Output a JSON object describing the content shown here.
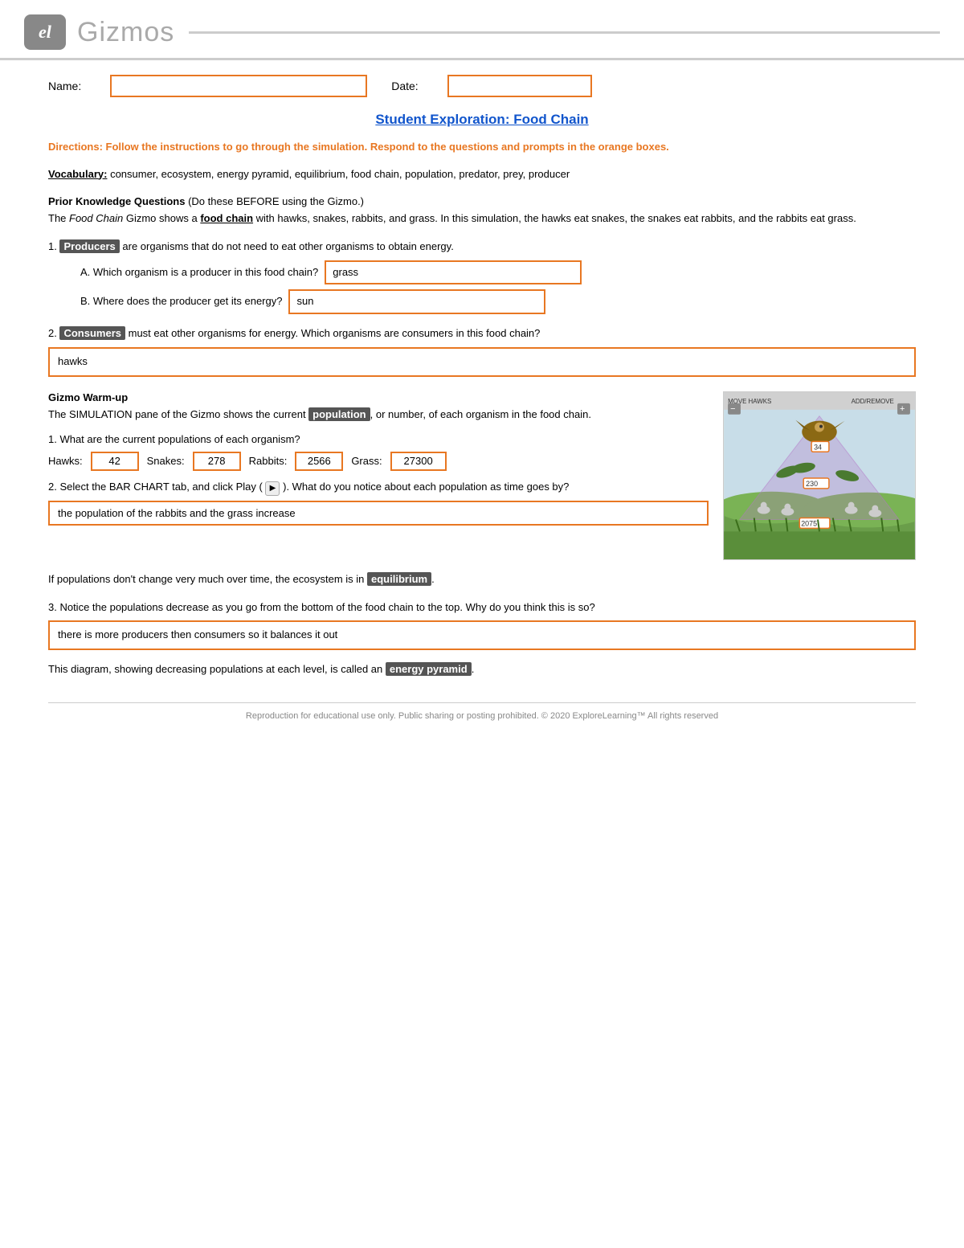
{
  "header": {
    "logo_text": "el",
    "title": "Gizmos"
  },
  "form": {
    "name_label": "Name:",
    "date_label": "Date:",
    "name_value": "",
    "date_value": ""
  },
  "document": {
    "title": "Student Exploration: Food Chain",
    "directions": "Directions: Follow the instructions to go through the simulation. Respond to the questions and prompts in the orange boxes.",
    "vocab_label": "Vocabulary:",
    "vocab_text": " consumer, ecosystem, energy pyramid, equilibrium, food chain, population, predator, prey, producer",
    "prior_knowledge_label": "Prior Knowledge Questions",
    "prior_knowledge_paren": "(Do these BEFORE using the Gizmo.)",
    "prior_knowledge_body": "The Food Chain Gizmo shows a food chain with hawks, snakes, rabbits, and grass. In this simulation, the hawks eat snakes, the snakes eat rabbits, and the rabbits eat grass.",
    "q1_text": "Producers are organisms that do not need to eat other organisms to obtain energy.",
    "q1a_label": "A. Which organism is a producer in this food chain?",
    "q1a_answer": "grass",
    "q1b_label": "B. Where does the producer get its energy?",
    "q1b_answer": "sun",
    "q2_text": "Consumers must eat other organisms for energy. Which organisms are consumers in this food chain?",
    "q2_answer": "hawks",
    "gizmo_warmup_title": "Gizmo Warm-up",
    "gizmo_warmup_body_pre": "The SIMULATION pane of the Gizmo shows the current ",
    "gizmo_warmup_highlight": "population",
    "gizmo_warmup_body_post": ", or number, of each organism in the food chain.",
    "pop_q1": "1.  What are the current populations of each organism?",
    "pop_hawks_label": "Hawks:",
    "pop_hawks_value": "42",
    "pop_snakes_label": "Snakes:",
    "pop_snakes_value": "278",
    "pop_rabbits_label": "Rabbits:",
    "pop_rabbits_value": "2566",
    "pop_grass_label": "Grass:",
    "pop_grass_value": "27300",
    "pop_q2": "2.  Select the BAR CHART tab, and click Play (",
    "pop_q2_play": "▶",
    "pop_q2_post": "). What do you notice about each population as time goes by?",
    "pop_q2_answer": "the population of the rabbits and the grass increase",
    "equilibrium_line": "If populations don't change very much over time, the ecosystem is in ",
    "equilibrium_highlight": "equilibrium",
    "equilibrium_end": ".",
    "pop_q3": "3.  Notice the populations decrease as you go from the bottom of the food chain to the top. Why do you think this is so?",
    "pop_q3_answer": "there is more producers then consumers so it balances it out",
    "energy_pyramid_line_pre": "This diagram, showing decreasing populations at each level, is called an ",
    "energy_pyramid_highlight": "energy pyramid",
    "energy_pyramid_end": ".",
    "footer_text": "Reproduction for educational use only. Public sharing or posting prohibited. © 2020 ExploreLearning™ All rights reserved"
  },
  "gizmo_image": {
    "move_hawks_label": "MOVE HAWKS",
    "add_remove_label": "ADD/REMOVE",
    "minus_label": "−",
    "plus_label": "+",
    "number_34": "34",
    "number_230": "230",
    "number_2075": "2075"
  }
}
